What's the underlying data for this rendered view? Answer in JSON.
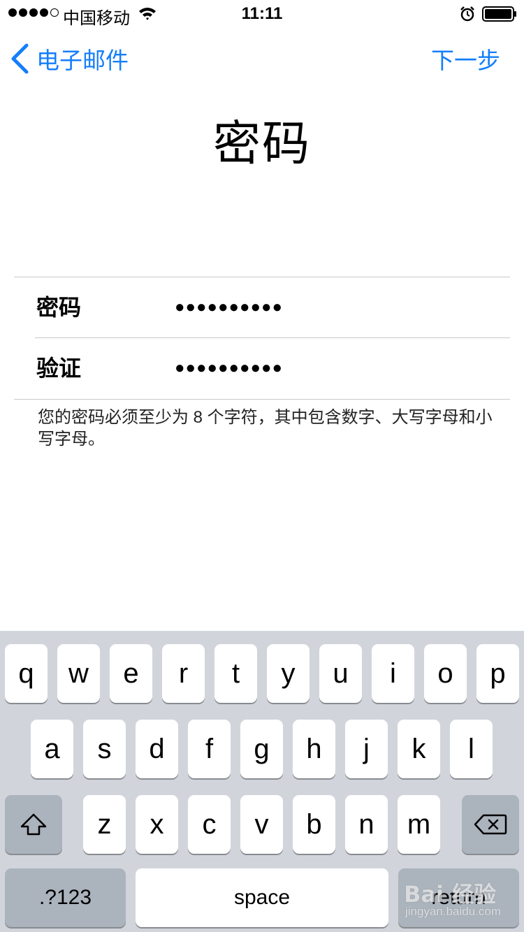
{
  "status_bar": {
    "carrier": "中国移动",
    "time": "11:11",
    "signal_bars_filled": 4,
    "signal_bars_total": 5
  },
  "nav": {
    "back_label": "电子邮件",
    "next_label": "下一步",
    "accent_color": "#147efb"
  },
  "title": "密码",
  "form": {
    "password_label": "密码",
    "password_value": "●●●●●●●●●●",
    "verify_label": "验证",
    "verify_value": "●●●●●●●●●●"
  },
  "hint": "您的密码必须至少为 8 个字符，其中包含数字、大写字母和小写字母。",
  "keyboard": {
    "row1": [
      "q",
      "w",
      "e",
      "r",
      "t",
      "y",
      "u",
      "i",
      "o",
      "p"
    ],
    "row2": [
      "a",
      "s",
      "d",
      "f",
      "g",
      "h",
      "j",
      "k",
      "l"
    ],
    "row3": [
      "z",
      "x",
      "c",
      "v",
      "b",
      "n",
      "m"
    ],
    "numbers_label": ".?123",
    "space_label": "space",
    "return_label": "return",
    "shift_icon": "shift-icon",
    "delete_icon": "backspace-icon"
  },
  "watermark": {
    "logo": "Bai 经验",
    "url": "jingyan.baidu.com"
  }
}
